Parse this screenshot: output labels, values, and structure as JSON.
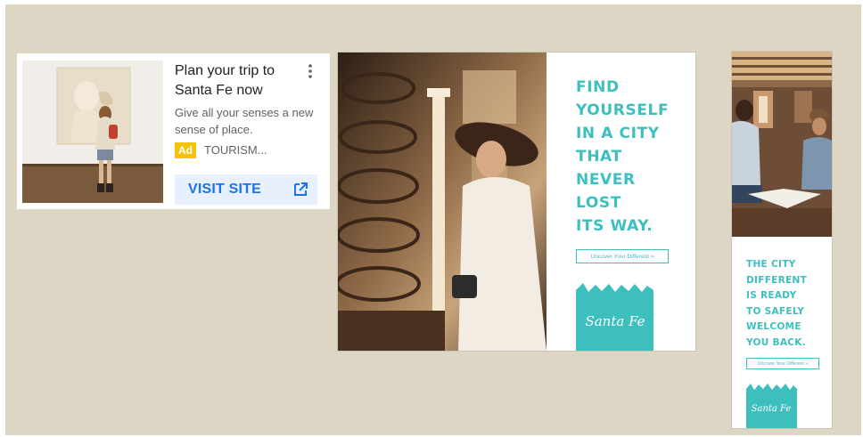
{
  "ad_search": {
    "title": "Plan your trip to Santa Fe now",
    "description": "Give all your senses a new sense of place.",
    "badge": "Ad",
    "advertiser": "TOURISM...",
    "cta_label": "VISIT SITE",
    "menu_icon": "more-vert-icon",
    "cta_icon": "open-in-new-icon",
    "colors": {
      "badge": "#f4c20d",
      "cta_text": "#1a73e8",
      "cta_bg": "#e8f0fe"
    }
  },
  "ad_square": {
    "headline": "FIND\nYOURSELF\nIN A CITY\nTHAT\nNEVER\nLOST\nITS WAY.",
    "button_label": "Uncover Your Different »",
    "logo_text": "Santa Fe",
    "colors": {
      "accent": "#3dbfbd"
    }
  },
  "ad_tall": {
    "headline": "THE CITY\nDIFFERENT\nIS READY\nTO SAFELY\nWELCOME\nYOU BACK.",
    "button_label": "Uncover Your Different »",
    "logo_text": "Santa Fe",
    "colors": {
      "accent": "#3dbfbd"
    }
  },
  "colors": {
    "background": "#ddd6c5"
  }
}
